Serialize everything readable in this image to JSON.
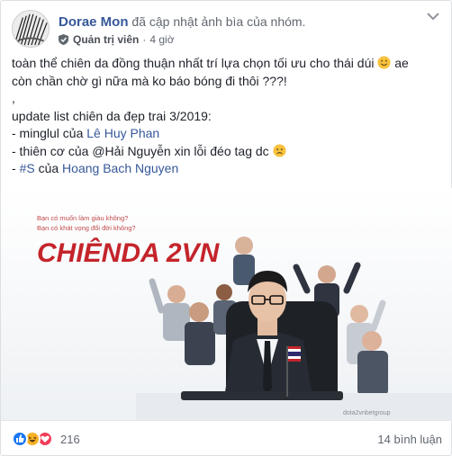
{
  "post": {
    "author_name": "Dorae Mon",
    "action_text": "đã cập nhật ảnh bìa của nhóm.",
    "role": "Quản trị viên",
    "separator": "·",
    "time_ago": "4 giờ",
    "body": {
      "line1": "toàn thể chiên da đồng thuận nhất trí lựa chọn tối ưu cho thái dúi",
      "line1_tail": "ae",
      "line2": "còn chần chờ gì nữa mà ko báo bóng đi thôi ???!",
      "line3": ",",
      "line4": "update list chiên da đẹp trai 3/2019:",
      "line5_prefix": "- minglul của ",
      "line5_link": "Lê Huy Phan",
      "line6": "- thiên cơ của @Hải Nguyễn xin lỗi đéo tag dc",
      "line7_prefix": "- ",
      "line7_hashtag": "#S",
      "line7_mid": " của ",
      "line7_link": "Hoang Bach Nguyen"
    },
    "cover": {
      "tagline1": "Bạn có muốn làm giàu không?",
      "tagline2": "Bạn có khát vọng đổi đời không?",
      "title": "CHIÊNDA 2VN",
      "watermark": "dota2vnbetgroup"
    },
    "reactions": {
      "count": "216",
      "icons": [
        "like-icon",
        "haha-icon",
        "love-icon"
      ]
    },
    "comments_label": "14 bình luận"
  },
  "colors": {
    "link": "#365899",
    "meta": "#616770",
    "title_red": "#c4242b",
    "like_blue": "#1877f2",
    "haha_yellow": "#f7b125",
    "love_red": "#f33e58"
  }
}
